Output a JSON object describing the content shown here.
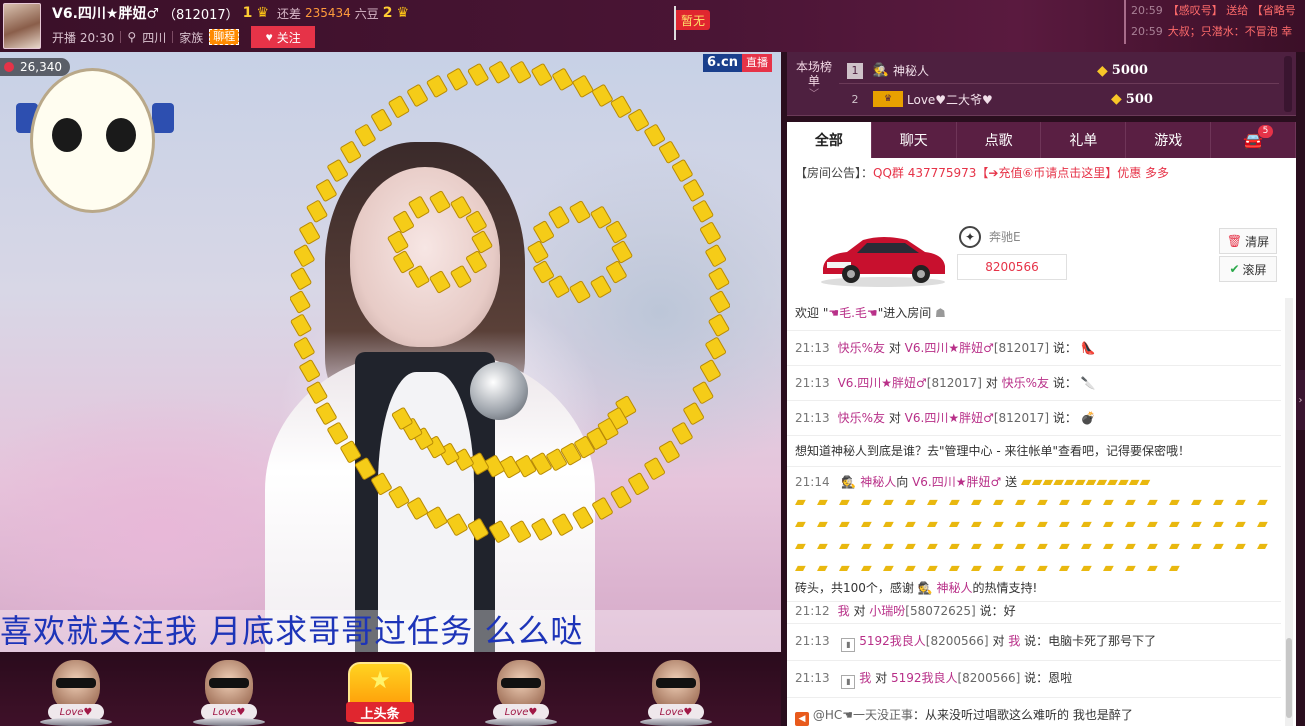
{
  "header": {
    "host_name": "V6.四川★胖妞♂",
    "host_id": "（812017）",
    "rank_current": "1",
    "diff_label": "还差",
    "diff_value": "235434",
    "diff_unit": "六豆",
    "rank_next": "2",
    "start_time": "开播 20:30",
    "location": "四川",
    "family_label": "家族",
    "family_tag": "聊程",
    "follow_label": "关注",
    "flag_label": "暂无",
    "top_msgs": [
      {
        "time": "20:59",
        "text": "【感叹号】 送给 【省略号"
      },
      {
        "time": "20:59",
        "text": "大叔；只潜水：不冒泡 幸"
      }
    ]
  },
  "video": {
    "viewer_count": "26,340",
    "brand_logo": "6.cn",
    "live_label": "直播",
    "marquee": "喜欢就关注我    月底求哥哥过任务    么么哒"
  },
  "bottom": {
    "seat_tag": "Love♥",
    "headline_label": "上头条"
  },
  "leaderboard": {
    "title": "本场榜单",
    "rows": [
      {
        "rank": "1",
        "name": "神秘人",
        "amount": "5000"
      },
      {
        "rank": "2",
        "name": "Love♥二大爷♥",
        "amount": "500"
      }
    ]
  },
  "tabs": [
    {
      "label": "全部"
    },
    {
      "label": "聊天"
    },
    {
      "label": "点歌"
    },
    {
      "label": "礼单"
    },
    {
      "label": "游戏"
    },
    {
      "label": "",
      "badge": "5"
    }
  ],
  "announce": {
    "label": "【房间公告】：",
    "text": "QQ群 437775973【➔充值⑥币请点击这里】优惠 多多"
  },
  "car": {
    "name": "奔驰E",
    "id": "8200566",
    "clear_label": "清屏",
    "scroll_label": "滚屏"
  },
  "chat": {
    "welcome": {
      "pre": "欢迎 \"",
      "name": "☚毛.毛☚",
      "post": "\"进入房间"
    },
    "m1": {
      "time": "21:13",
      "from": "快乐%友",
      "to_word": "对",
      "to": "V6.四川★胖妞♂",
      "to_id": "[812017]",
      "say": "说："
    },
    "m2": {
      "time": "21:13",
      "from": "V6.四川★胖妞♂",
      "from_id": "[812017]",
      "to_word": "对",
      "to": "快乐%友",
      "say": "说："
    },
    "m3": {
      "time": "21:13",
      "from": "快乐%友",
      "to_word": "对",
      "to": "V6.四川★胖妞♂",
      "to_id": "[812017]",
      "say": "说："
    },
    "system": "想知道神秘人到底是谁？去\"管理中心 - 来往帐单\"查看吧，记得要保密哦！",
    "gift": {
      "time": "21:14",
      "from": "神秘人",
      "to_word": "向",
      "to": "V6.四川★胖妞♂",
      "send": "送",
      "summary": "砖头，共100个，感谢",
      "thanks_name": "神秘人",
      "thanks_post": "的热情支持!"
    },
    "m4": {
      "time": "21:12",
      "from": "我",
      "to_word": "对",
      "to": "小瑞吩",
      "to_id": "[58072625]",
      "say": "说：好"
    },
    "m5": {
      "time": "21:13",
      "from": "5192我良人",
      "from_id": "[8200566]",
      "to_word": "对",
      "to": "我",
      "say": "说：电脑卡死了那号下了"
    },
    "m6": {
      "time": "21:13",
      "from": "我",
      "to_word": "对",
      "to": "5192我良人",
      "to_id": "[8200566]",
      "say": "说：恩啦"
    },
    "m7": {
      "from": "@HC☚一天没正事",
      "text": "：从来没听过唱歌这么难听的 我也是醉了"
    }
  },
  "colors": {
    "accent": "#e63348",
    "username": "#b82f88",
    "header_bg": "#4a1535",
    "marquee": "#1d34b8",
    "gift_gold": "#e9b80f"
  }
}
